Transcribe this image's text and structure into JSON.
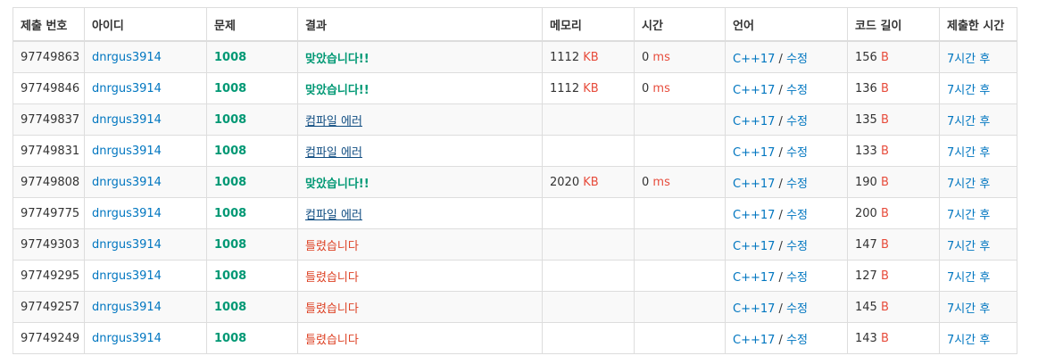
{
  "colors": {
    "link": "#0076c0",
    "accepted": "#009874",
    "wrong": "#dd4124",
    "compile_error": "#0f4c81",
    "unit": "#e74c3c"
  },
  "headers": [
    "제출 번호",
    "아이디",
    "문제",
    "결과",
    "메모리",
    "시간",
    "언어",
    "코드 길이",
    "제출한 시간"
  ],
  "rows": [
    {
      "id": "97749863",
      "user": "dnrgus3914",
      "problem": "1008",
      "result": "맞았습니다!!",
      "result_type": "ac",
      "memory": "1112",
      "memory_unit": "KB",
      "time": "0",
      "time_unit": "ms",
      "lang": "C++17",
      "edit": "수정",
      "code_len": "156",
      "code_unit": "B",
      "submitted": "7시간 후"
    },
    {
      "id": "97749846",
      "user": "dnrgus3914",
      "problem": "1008",
      "result": "맞았습니다!!",
      "result_type": "ac",
      "memory": "1112",
      "memory_unit": "KB",
      "time": "0",
      "time_unit": "ms",
      "lang": "C++17",
      "edit": "수정",
      "code_len": "136",
      "code_unit": "B",
      "submitted": "7시간 후"
    },
    {
      "id": "97749837",
      "user": "dnrgus3914",
      "problem": "1008",
      "result": "컴파일 에러",
      "result_type": "ce",
      "memory": "",
      "memory_unit": "",
      "time": "",
      "time_unit": "",
      "lang": "C++17",
      "edit": "수정",
      "code_len": "135",
      "code_unit": "B",
      "submitted": "7시간 후"
    },
    {
      "id": "97749831",
      "user": "dnrgus3914",
      "problem": "1008",
      "result": "컴파일 에러",
      "result_type": "ce",
      "memory": "",
      "memory_unit": "",
      "time": "",
      "time_unit": "",
      "lang": "C++17",
      "edit": "수정",
      "code_len": "133",
      "code_unit": "B",
      "submitted": "7시간 후"
    },
    {
      "id": "97749808",
      "user": "dnrgus3914",
      "problem": "1008",
      "result": "맞았습니다!!",
      "result_type": "ac",
      "memory": "2020",
      "memory_unit": "KB",
      "time": "0",
      "time_unit": "ms",
      "lang": "C++17",
      "edit": "수정",
      "code_len": "190",
      "code_unit": "B",
      "submitted": "7시간 후"
    },
    {
      "id": "97749775",
      "user": "dnrgus3914",
      "problem": "1008",
      "result": "컴파일 에러",
      "result_type": "ce",
      "memory": "",
      "memory_unit": "",
      "time": "",
      "time_unit": "",
      "lang": "C++17",
      "edit": "수정",
      "code_len": "200",
      "code_unit": "B",
      "submitted": "7시간 후"
    },
    {
      "id": "97749303",
      "user": "dnrgus3914",
      "problem": "1008",
      "result": "틀렸습니다",
      "result_type": "wa",
      "memory": "",
      "memory_unit": "",
      "time": "",
      "time_unit": "",
      "lang": "C++17",
      "edit": "수정",
      "code_len": "147",
      "code_unit": "B",
      "submitted": "7시간 후"
    },
    {
      "id": "97749295",
      "user": "dnrgus3914",
      "problem": "1008",
      "result": "틀렸습니다",
      "result_type": "wa",
      "memory": "",
      "memory_unit": "",
      "time": "",
      "time_unit": "",
      "lang": "C++17",
      "edit": "수정",
      "code_len": "127",
      "code_unit": "B",
      "submitted": "7시간 후"
    },
    {
      "id": "97749257",
      "user": "dnrgus3914",
      "problem": "1008",
      "result": "틀렸습니다",
      "result_type": "wa",
      "memory": "",
      "memory_unit": "",
      "time": "",
      "time_unit": "",
      "lang": "C++17",
      "edit": "수정",
      "code_len": "145",
      "code_unit": "B",
      "submitted": "7시간 후"
    },
    {
      "id": "97749249",
      "user": "dnrgus3914",
      "problem": "1008",
      "result": "틀렸습니다",
      "result_type": "wa",
      "memory": "",
      "memory_unit": "",
      "time": "",
      "time_unit": "",
      "lang": "C++17",
      "edit": "수정",
      "code_len": "143",
      "code_unit": "B",
      "submitted": "7시간 후"
    }
  ]
}
